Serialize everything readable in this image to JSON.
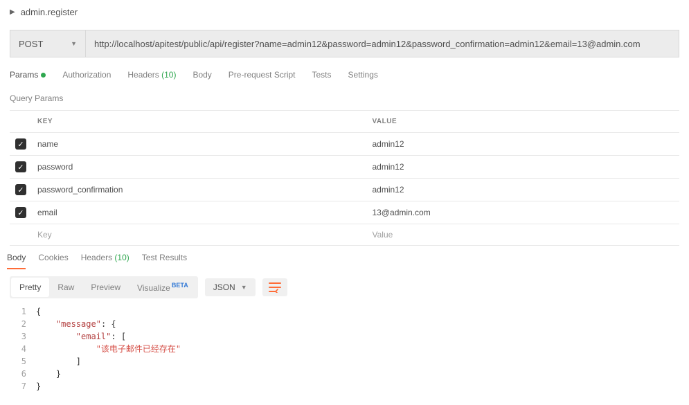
{
  "header": {
    "request_name": "admin.register"
  },
  "request": {
    "method": "POST",
    "url": "http://localhost/apitest/public/api/register?name=admin12&password=admin12&password_confirmation=admin12&email=13@admin.com"
  },
  "tabs": {
    "params": "Params",
    "authorization": "Authorization",
    "headers": "Headers",
    "headers_count": "(10)",
    "body": "Body",
    "prerequest": "Pre-request Script",
    "tests": "Tests",
    "settings": "Settings"
  },
  "section": {
    "query_params": "Query Params"
  },
  "table": {
    "key_header": "KEY",
    "value_header": "VALUE",
    "rows": [
      {
        "checked": true,
        "key": "name",
        "value": "admin12"
      },
      {
        "checked": true,
        "key": "password",
        "value": "admin12"
      },
      {
        "checked": true,
        "key": "password_confirmation",
        "value": "admin12"
      },
      {
        "checked": true,
        "key": "email",
        "value": "13@admin.com"
      }
    ],
    "placeholder_key": "Key",
    "placeholder_value": "Value"
  },
  "response_tabs": {
    "body": "Body",
    "cookies": "Cookies",
    "headers": "Headers",
    "headers_count": "(10)",
    "tests": "Test Results"
  },
  "view": {
    "pretty": "Pretty",
    "raw": "Raw",
    "preview": "Preview",
    "visualize": "Visualize",
    "beta": "BETA",
    "format": "JSON"
  },
  "code": {
    "l1": "{",
    "l2a": "    ",
    "l2k": "\"message\"",
    "l2b": ": {",
    "l3a": "        ",
    "l3k": "\"email\"",
    "l3b": ": [",
    "l4a": "            ",
    "l4s": "\"该电子邮件已经存在\"",
    "l5": "        ]",
    "l6": "    }",
    "l7": "}"
  },
  "chart_data": {
    "type": "table",
    "response_json": {
      "message": {
        "email": [
          "该电子邮件已经存在"
        ]
      }
    }
  }
}
